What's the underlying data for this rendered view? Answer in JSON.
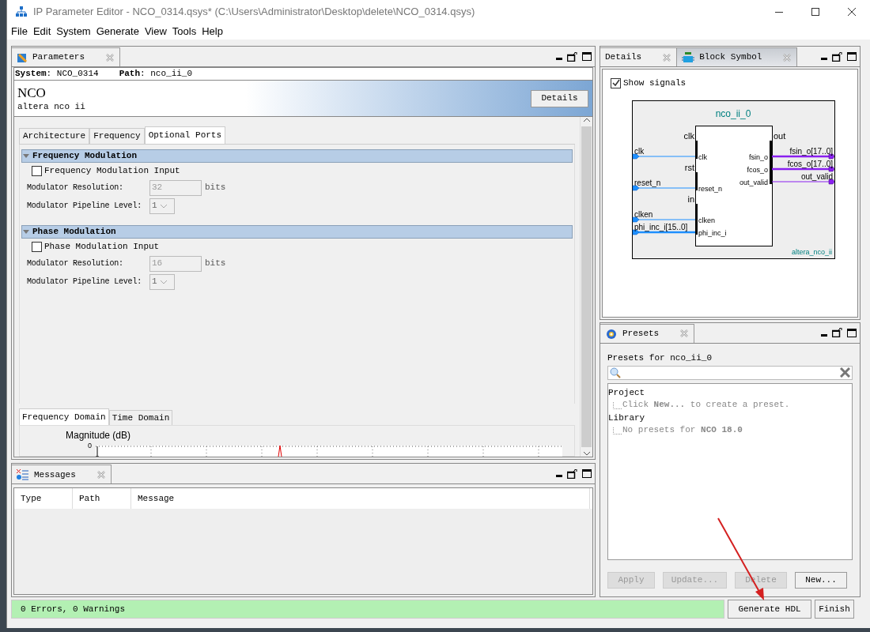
{
  "window": {
    "title": "IP Parameter Editor - NCO_0314.qsys* (C:\\Users\\Administrator\\Desktop\\delete\\NCO_0314.qsys)"
  },
  "menu": [
    "File",
    "Edit",
    "System",
    "Generate",
    "View",
    "Tools",
    "Help"
  ],
  "parameters_panel": {
    "tab": "Parameters",
    "system_label": "**System**: NCO_0314",
    "path_label": "**Path**: nco_ii_0",
    "component_name": "NCO",
    "component_type": "altera nco ii",
    "details_button": "Details",
    "tabs": [
      {
        "label": "Architecture",
        "selected": false
      },
      {
        "label": "Frequency",
        "selected": false
      },
      {
        "label": "Optional Ports",
        "selected": true
      }
    ],
    "sections": [
      {
        "title": "Frequency Modulation",
        "expanded": true,
        "checkbox": {
          "label": "Frequency Modulation Input",
          "checked": false
        },
        "resolution": {
          "label": "Modulator Resolution:",
          "value": "32",
          "unit": "bits",
          "disabled": true
        },
        "pipeline": {
          "label": "Modulator Pipeline Level:",
          "value": "1",
          "disabled": true
        }
      },
      {
        "title": "Phase Modulation",
        "expanded": true,
        "checkbox": {
          "label": "Phase Modulation Input",
          "checked": false
        },
        "resolution": {
          "label": "Modulator Resolution:",
          "value": "16",
          "unit": "bits",
          "disabled": true
        },
        "pipeline": {
          "label": "Modulator Pipeline Level:",
          "value": "1",
          "disabled": true
        }
      }
    ],
    "plot_tabs": [
      {
        "label": "Frequency Domain",
        "selected": true
      },
      {
        "label": "Time Domain",
        "selected": false
      }
    ],
    "plot": {
      "ylabel": "Magnitude (dB)",
      "ytick": "0"
    }
  },
  "messages_panel": {
    "tab": "Messages",
    "columns": [
      "Type",
      "Path",
      "Message"
    ]
  },
  "side_tabs": [
    {
      "label": "Details",
      "selected": false
    },
    {
      "label": "Block Symbol",
      "selected": true
    }
  ],
  "block_symbol": {
    "show_signals": {
      "label": "Show signals",
      "checked": true
    },
    "instance": "nco_ii_0",
    "module": "altera_nco_ii",
    "inputs": [
      {
        "interface": "clk",
        "ports": [
          {
            "port": "clk",
            "signal": "clk",
            "bus": false
          }
        ]
      },
      {
        "interface": "rst",
        "ports": [
          {
            "port": "reset_n",
            "signal": "reset_n",
            "bus": false
          }
        ]
      },
      {
        "interface": "in",
        "ports": [
          {
            "port": "clken",
            "signal": "clken",
            "bus": false
          },
          {
            "port": "phi_inc_i",
            "signal": "phi_inc_i[15..0]",
            "bus": true
          }
        ]
      }
    ],
    "outputs": [
      {
        "interface": "out",
        "ports": [
          {
            "port": "fsin_o",
            "signal": "fsin_o[17..0]",
            "bus": true
          },
          {
            "port": "fcos_o",
            "signal": "fcos_o[17..0]",
            "bus": true
          },
          {
            "port": "out_valid",
            "signal": "out_valid",
            "bus": false
          }
        ]
      }
    ]
  },
  "presets": {
    "tab": "Presets",
    "heading": "Presets for nco_ii_0",
    "tree": [
      {
        "label": "Project",
        "children": [
          {
            "label": "Click **New...** to create a preset."
          }
        ]
      },
      {
        "label": "Library",
        "children": [
          {
            "label": "No presets for **NCO 18.0**"
          }
        ]
      }
    ],
    "buttons": [
      {
        "label": "Apply",
        "disabled": true
      },
      {
        "label": "Update...",
        "disabled": true
      },
      {
        "label": "Delete",
        "disabled": true
      },
      {
        "label": "New...",
        "disabled": false
      }
    ]
  },
  "status": "0 Errors, 0 Warnings",
  "buttons": [
    {
      "label": "Generate HDL"
    },
    {
      "label": "Finish"
    }
  ]
}
